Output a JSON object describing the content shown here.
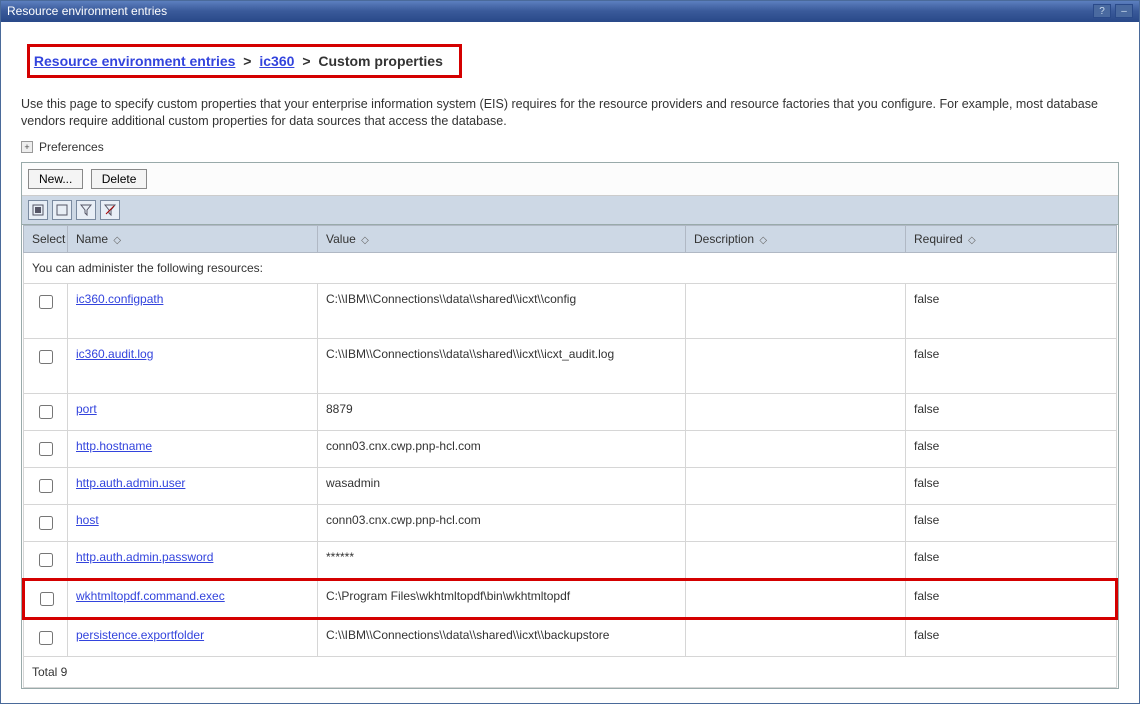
{
  "window": {
    "title": "Resource environment entries"
  },
  "breadcrumb": {
    "link1": "Resource environment entries",
    "link2": "ic360",
    "tail": "Custom properties",
    "sep": ">"
  },
  "description": "Use this page to specify custom properties that your enterprise information system (EIS) requires for the resource providers and resource factories that you configure. For example, most database vendors require additional custom properties for data sources that access the database.",
  "preferences_label": "Preferences",
  "buttons": {
    "new": "New...",
    "delete": "Delete"
  },
  "columns": {
    "select": "Select",
    "name": "Name",
    "value": "Value",
    "description": "Description",
    "required": "Required"
  },
  "group_header": "You can administer the following resources:",
  "rows": [
    {
      "name": "ic360.configpath",
      "value": "C:\\\\IBM\\\\Connections\\\\data\\\\shared\\\\icxt\\\\config",
      "description": "",
      "required": "false",
      "tall": true
    },
    {
      "name": "ic360.audit.log",
      "value": "C:\\\\IBM\\\\Connections\\\\data\\\\shared\\\\icxt\\\\icxt_audit.log",
      "description": "",
      "required": "false",
      "tall": true
    },
    {
      "name": "port",
      "value": "8879",
      "description": "",
      "required": "false"
    },
    {
      "name": "http.hostname",
      "value": "conn03.cnx.cwp.pnp-hcl.com",
      "description": "",
      "required": "false"
    },
    {
      "name": "http.auth.admin.user",
      "value": "wasadmin",
      "description": "",
      "required": "false"
    },
    {
      "name": "host",
      "value": "conn03.cnx.cwp.pnp-hcl.com",
      "description": "",
      "required": "false"
    },
    {
      "name": "http.auth.admin.password",
      "value": "******",
      "description": "",
      "required": "false"
    },
    {
      "name": "wkhtmltopdf.command.exec",
      "value": "C:\\Program Files\\wkhtmltopdf\\bin\\wkhtmltopdf",
      "description": "",
      "required": "false",
      "highlight": true
    },
    {
      "name": "persistence.exportfolder",
      "value": "C:\\\\IBM\\\\Connections\\\\data\\\\shared\\\\icxt\\\\backupstore",
      "description": "",
      "required": "false"
    }
  ],
  "total_label": "Total 9"
}
